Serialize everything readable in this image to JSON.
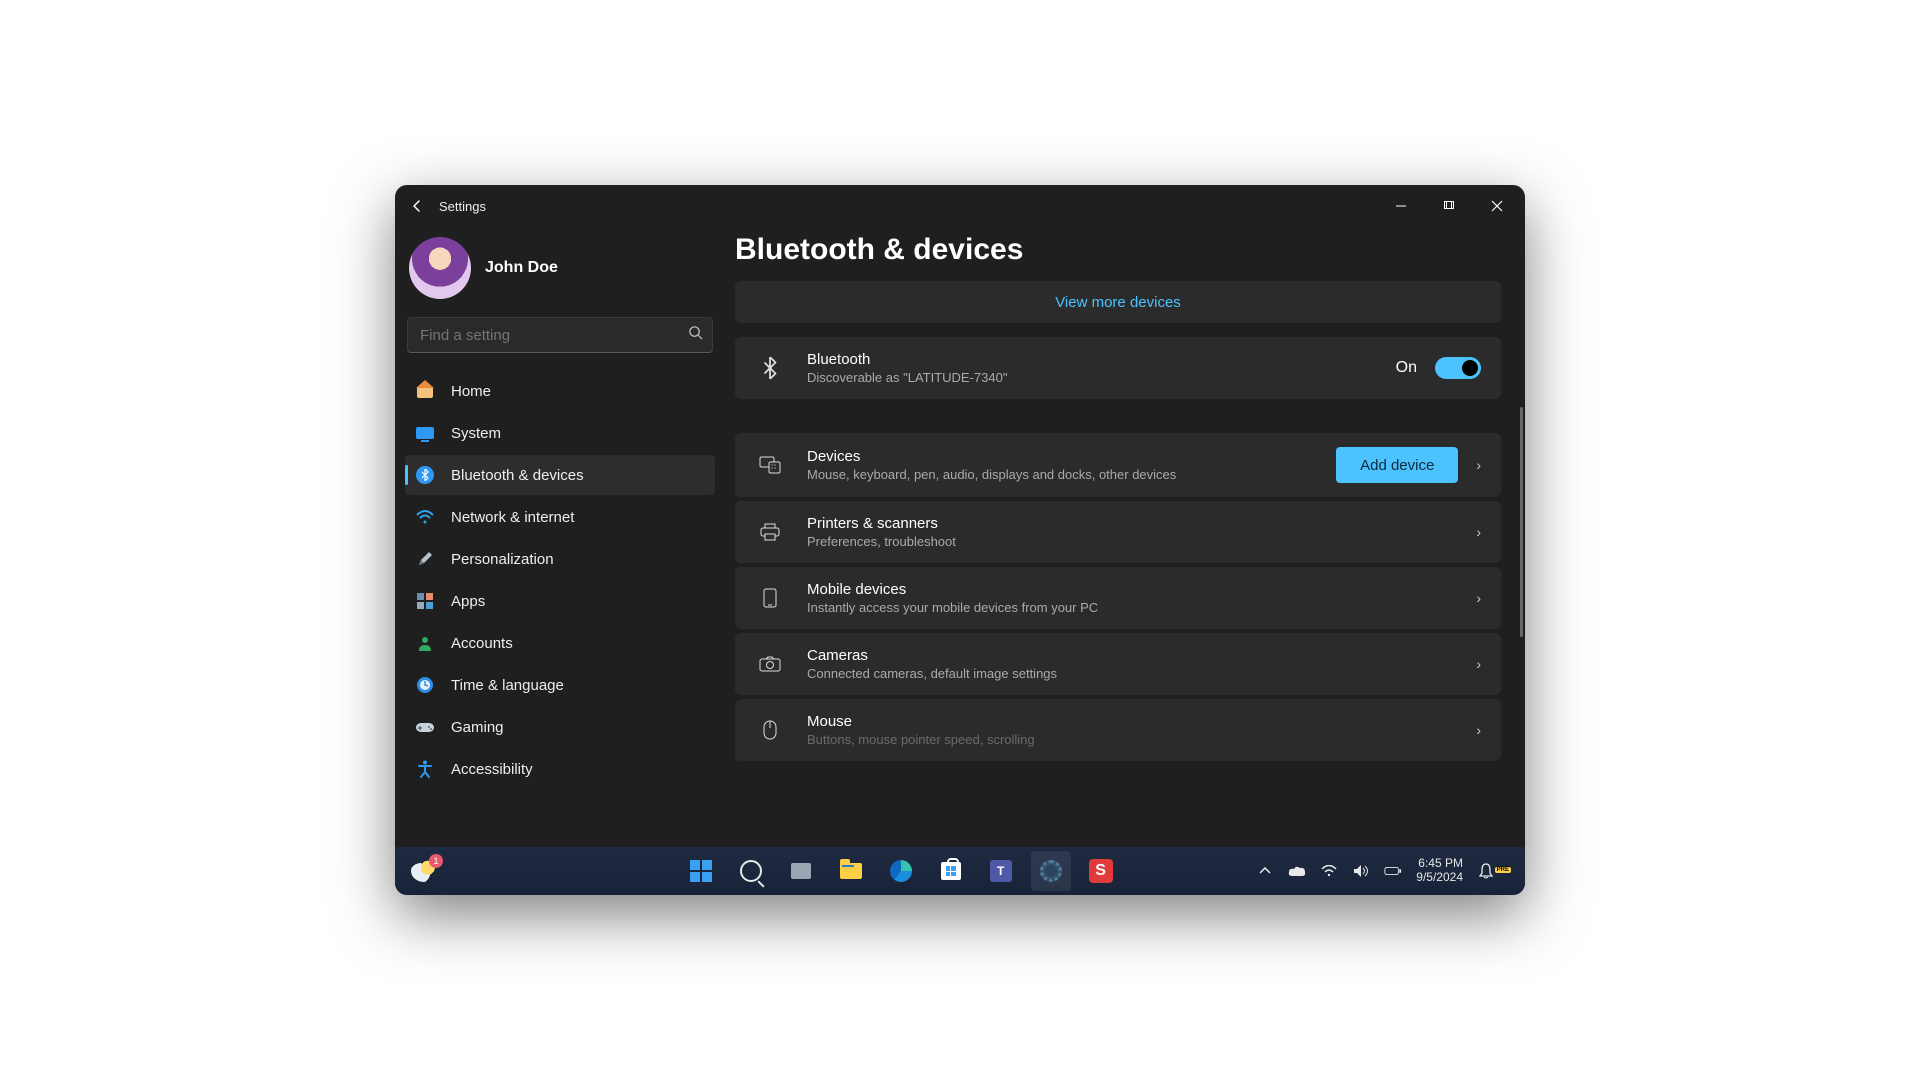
{
  "window": {
    "title": "Settings"
  },
  "user": {
    "name": "John Doe"
  },
  "search": {
    "placeholder": "Find a setting"
  },
  "sidebar": {
    "items": [
      {
        "label": "Home"
      },
      {
        "label": "System"
      },
      {
        "label": "Bluetooth & devices"
      },
      {
        "label": "Network & internet"
      },
      {
        "label": "Personalization"
      },
      {
        "label": "Apps"
      },
      {
        "label": "Accounts"
      },
      {
        "label": "Time & language"
      },
      {
        "label": "Gaming"
      },
      {
        "label": "Accessibility"
      }
    ],
    "selected_index": 2
  },
  "page": {
    "title": "Bluetooth & devices",
    "view_more": "View more devices",
    "bluetooth": {
      "title": "Bluetooth",
      "subtitle": "Discoverable as \"LATITUDE-7340\"",
      "state_label": "On",
      "on": true
    },
    "sections": [
      {
        "title": "Devices",
        "subtitle": "Mouse, keyboard, pen, audio, displays and docks, other devices",
        "button": "Add device"
      },
      {
        "title": "Printers & scanners",
        "subtitle": "Preferences, troubleshoot"
      },
      {
        "title": "Mobile devices",
        "subtitle": "Instantly access your mobile devices from your PC"
      },
      {
        "title": "Cameras",
        "subtitle": "Connected cameras, default image settings"
      },
      {
        "title": "Mouse",
        "subtitle": "Buttons, mouse pointer speed, scrolling"
      }
    ]
  },
  "taskbar": {
    "weather_badge": "1",
    "time": "6:45 PM",
    "date": "9/5/2024"
  }
}
